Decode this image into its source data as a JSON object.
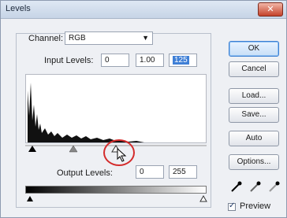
{
  "window": {
    "title": "Levels"
  },
  "channel": {
    "label": "Channel:",
    "value": "RGB"
  },
  "input_levels": {
    "label": "Input Levels:",
    "black": "0",
    "gamma": "1.00",
    "white": "125"
  },
  "output_levels": {
    "label": "Output Levels:",
    "black": "0",
    "white": "255"
  },
  "buttons": {
    "ok": "OK",
    "cancel": "Cancel",
    "load": "Load...",
    "save": "Save...",
    "auto": "Auto",
    "options": "Options..."
  },
  "preview": {
    "label": "Preview",
    "checked": true
  },
  "icons": {
    "droppers": [
      "black-eyedropper-icon",
      "gray-eyedropper-icon",
      "white-eyedropper-icon"
    ],
    "cursor": "arrow-cursor-icon"
  },
  "colors": {
    "highlight": "#3f7fd6",
    "circle": "#d42c2c"
  }
}
